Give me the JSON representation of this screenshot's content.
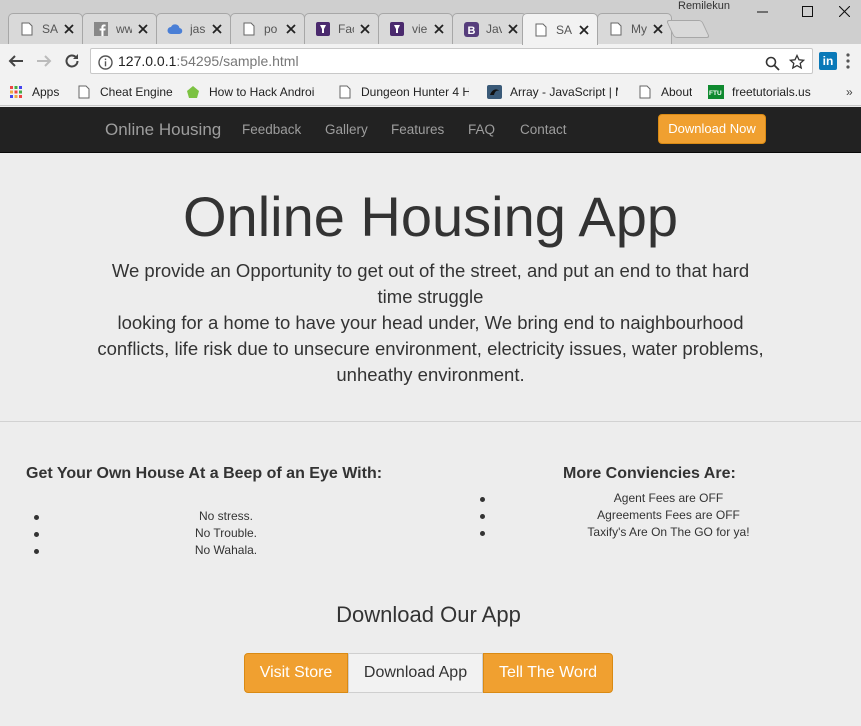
{
  "browser": {
    "profile_name": "Remilekun",
    "tabs": [
      {
        "title": "SA",
        "icon": "page-icon"
      },
      {
        "title": "ww",
        "icon": "facebook-icon"
      },
      {
        "title": "jas",
        "icon": "cloud-icon"
      },
      {
        "title": "po",
        "icon": "page-icon"
      },
      {
        "title": "Fac",
        "icon": "brand-icon"
      },
      {
        "title": "vie",
        "icon": "brand-icon"
      },
      {
        "title": "Jav",
        "icon": "bootstrap-icon"
      },
      {
        "title": "SA",
        "icon": "page-icon",
        "active": true
      },
      {
        "title": "My",
        "icon": "page-icon"
      }
    ],
    "url_host": "127.0.0.1",
    "url_rest": ":54295/sample.html",
    "linkedin_label": "in",
    "bookmarks": [
      {
        "label": "Apps",
        "icon": "apps-grid-icon"
      },
      {
        "label": "Cheat Engine",
        "icon": "page-icon"
      },
      {
        "label": "How to Hack Androi",
        "icon": "android-icon"
      },
      {
        "label": "Dungeon Hunter 4 H",
        "icon": "page-icon"
      },
      {
        "label": "Array - JavaScript | M",
        "icon": "mdn-icon"
      },
      {
        "label": "About",
        "icon": "page-icon"
      },
      {
        "label": "freetutorials.us",
        "icon": "ftu-icon"
      }
    ],
    "bookmarks_more": "»"
  },
  "navbar": {
    "brand": "Online Housing",
    "links": [
      "Feedback",
      "Gallery",
      "Features",
      "FAQ",
      "Contact"
    ],
    "download_now": "Download Now"
  },
  "hero": {
    "title": "Online Housing App",
    "paragraph_1": "We provide an Opportunity to get out of the street, and put an end to that hard time struggle",
    "paragraph_2": "looking for a home to have your head under, We bring end to naighbourhood conflicts, life risk due to unsecure environment, electricity issues, water problems, unheathy environment."
  },
  "left_column": {
    "heading": "Get Your Own House At a Beep of an Eye With:",
    "items": [
      "No stress.",
      "No Trouble.",
      "No Wahala."
    ]
  },
  "right_column": {
    "heading": "More Conviencies Are:",
    "items": [
      "Agent Fees are OFF",
      "Agreements Fees are OFF",
      "Taxify's Are On The GO for ya!"
    ]
  },
  "download": {
    "title": "Download Our App",
    "buttons": [
      "Visit Store",
      "Download App",
      "Tell The Word"
    ]
  },
  "colors": {
    "accent": "#f0a030",
    "navbar_bg": "#222222",
    "page_bg": "#ededed"
  }
}
